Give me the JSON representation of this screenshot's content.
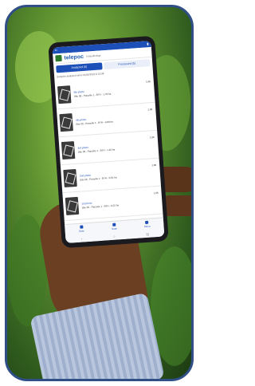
{
  "phone": {
    "brand": "telepoc",
    "brand_sub": "Telepathology",
    "tabs": [
      "Analyzed (5)",
      "Processed (5)"
    ],
    "note": "Samples analyzed since 01/06/2022 & 10:38",
    "rows": [
      {
        "title": "5th photo",
        "line": "Site 05 - Parcelle 1 - B7H - 1.78 ha",
        "value": "1.06"
      },
      {
        "title": "4th photo",
        "line": "Site 05 - Parcelle 1 - B7H - 0.83 ha",
        "value": "1.06"
      },
      {
        "title": "3rd photo",
        "line": "Site 05 - Parcelle 1 - B7H - 1.40 ha",
        "value": "1.06"
      },
      {
        "title": "2nd photo",
        "line": "Site 05 - Parcelle 1 - B7H - 0.61 ha",
        "value": "1.06"
      },
      {
        "title": "1st photo",
        "line": "Site 05 - Parcelle 1 - B7H - 0.22 ha",
        "value": "1.06"
      }
    ],
    "nav": [
      "Data",
      "Scan",
      "Menu"
    ]
  }
}
